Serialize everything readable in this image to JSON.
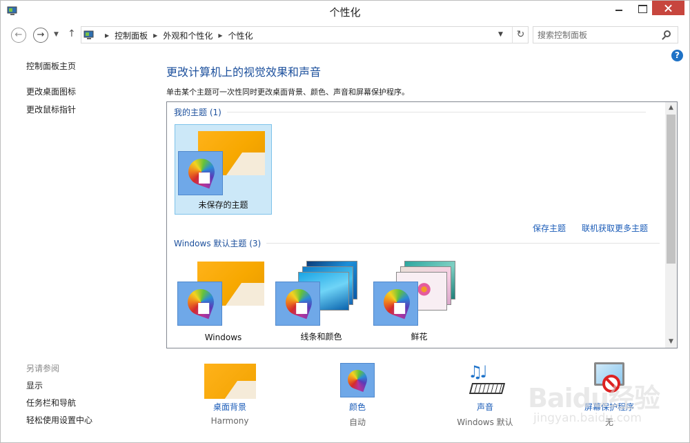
{
  "window": {
    "title": "个性化"
  },
  "address": {
    "breadcrumbs": [
      "控制面板",
      "外观和个性化",
      "个性化"
    ],
    "search_placeholder": "搜索控制面板"
  },
  "left_nav": {
    "home": "控制面板主页",
    "change_desktop_icons": "更改桌面图标",
    "change_mouse_pointers": "更改鼠标指针",
    "see_also": "另请参阅",
    "display": "显示",
    "taskbar": "任务栏和导航",
    "ease_of_access": "轻松使用设置中心"
  },
  "main": {
    "title": "更改计算机上的视觉效果和声音",
    "description": "单击某个主题可一次性同时更改桌面背景、颜色、声音和屏幕保护程序。",
    "my_themes_header": "我的主题 (1)",
    "my_themes": [
      {
        "label": "未保存的主题",
        "selected": true
      }
    ],
    "save_theme_link": "保存主题",
    "get_more_link": "联机获取更多主题",
    "default_themes_header": "Windows 默认主题 (3)",
    "default_themes": [
      {
        "label": "Windows"
      },
      {
        "label": "线条和颜色"
      },
      {
        "label": "鲜花"
      }
    ]
  },
  "bottom": {
    "desktop_background": {
      "title": "桌面背景",
      "value": "Harmony"
    },
    "color": {
      "title": "颜色",
      "value": "自动"
    },
    "sound": {
      "title": "声音",
      "value": "Windows 默认"
    },
    "screen_saver": {
      "title": "屏幕保护程序",
      "value": "无"
    }
  },
  "watermark": {
    "main": "Baidu经验",
    "sub": "jingyan.baidu.com"
  },
  "colors": {
    "link": "#1b5cb8",
    "heading": "#1b4f9c",
    "selection": "#cce8f8",
    "close_button": "#c7463e",
    "help": "#1f72c6"
  }
}
